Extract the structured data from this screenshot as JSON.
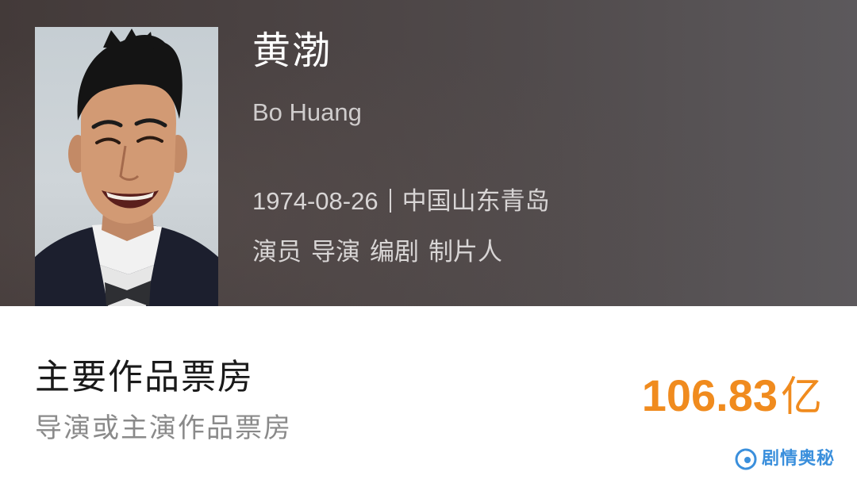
{
  "profile": {
    "name_cn": "黄渤",
    "name_en": "Bo Huang",
    "birth_date": "1974-08-26",
    "birth_place": "中国山东青岛",
    "roles": [
      "演员",
      "导演",
      "编剧",
      "制片人"
    ]
  },
  "box_office": {
    "title": "主要作品票房",
    "subtitle": "导演或主演作品票房",
    "value": "106.83",
    "unit": "亿"
  },
  "watermark": {
    "text": "剧情奥秘",
    "icon": "watermark-logo-icon"
  },
  "colors": {
    "accent": "#f08b1e",
    "header_bg": "#4a4242",
    "watermark": "#3a8fdc"
  }
}
